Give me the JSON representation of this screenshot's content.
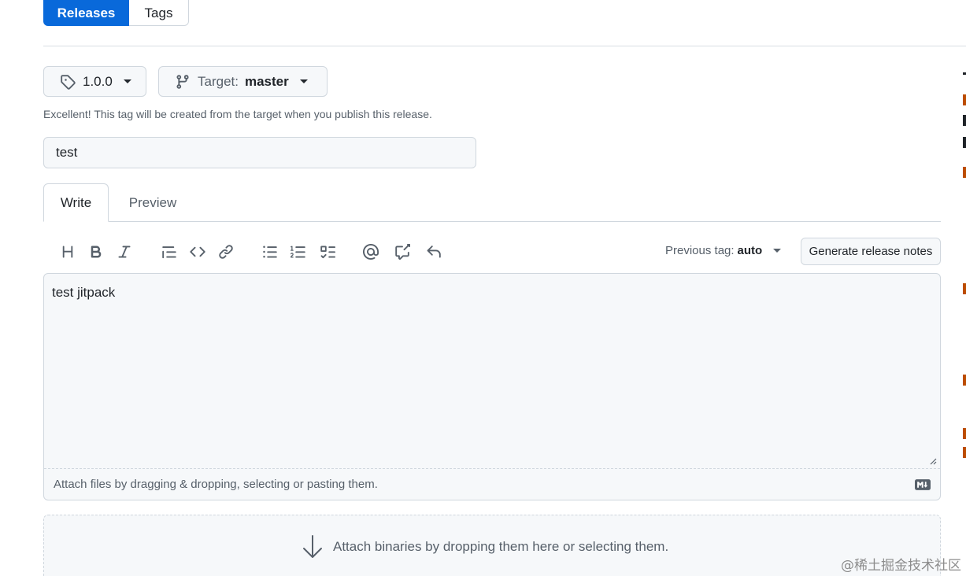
{
  "nav": {
    "releases_label": "Releases",
    "tags_label": "Tags"
  },
  "release": {
    "tag_value": "1.0.0",
    "target_label": "Target:",
    "target_value": "master",
    "hint": "Excellent! This tag will be created from the target when you publish this release.",
    "title_value": "test"
  },
  "editor": {
    "tab_write": "Write",
    "tab_preview": "Preview",
    "previous_tag_label": "Previous tag:",
    "previous_tag_value": "auto",
    "generate_notes_label": "Generate release notes",
    "body_value": "test jitpack",
    "attach_files_text": "Attach files by dragging & dropping, selecting or pasting them."
  },
  "binaries": {
    "drop_text": "Attach binaries by dropping them here or selecting them."
  },
  "watermark": "@稀土掘金技术社区",
  "colors": {
    "accent": "#0969da",
    "border": "#d0d7de",
    "muted_text": "#57606a",
    "field_bg": "#f6f8fa"
  },
  "icons": [
    "tag-icon",
    "git-branch-icon",
    "heading-icon",
    "bold-icon",
    "italic-icon",
    "quote-icon",
    "code-icon",
    "link-icon",
    "unordered-list-icon",
    "ordered-list-icon",
    "task-list-icon",
    "mention-icon",
    "cross-reference-icon",
    "reply-icon",
    "markdown-icon",
    "arrow-down-icon"
  ]
}
